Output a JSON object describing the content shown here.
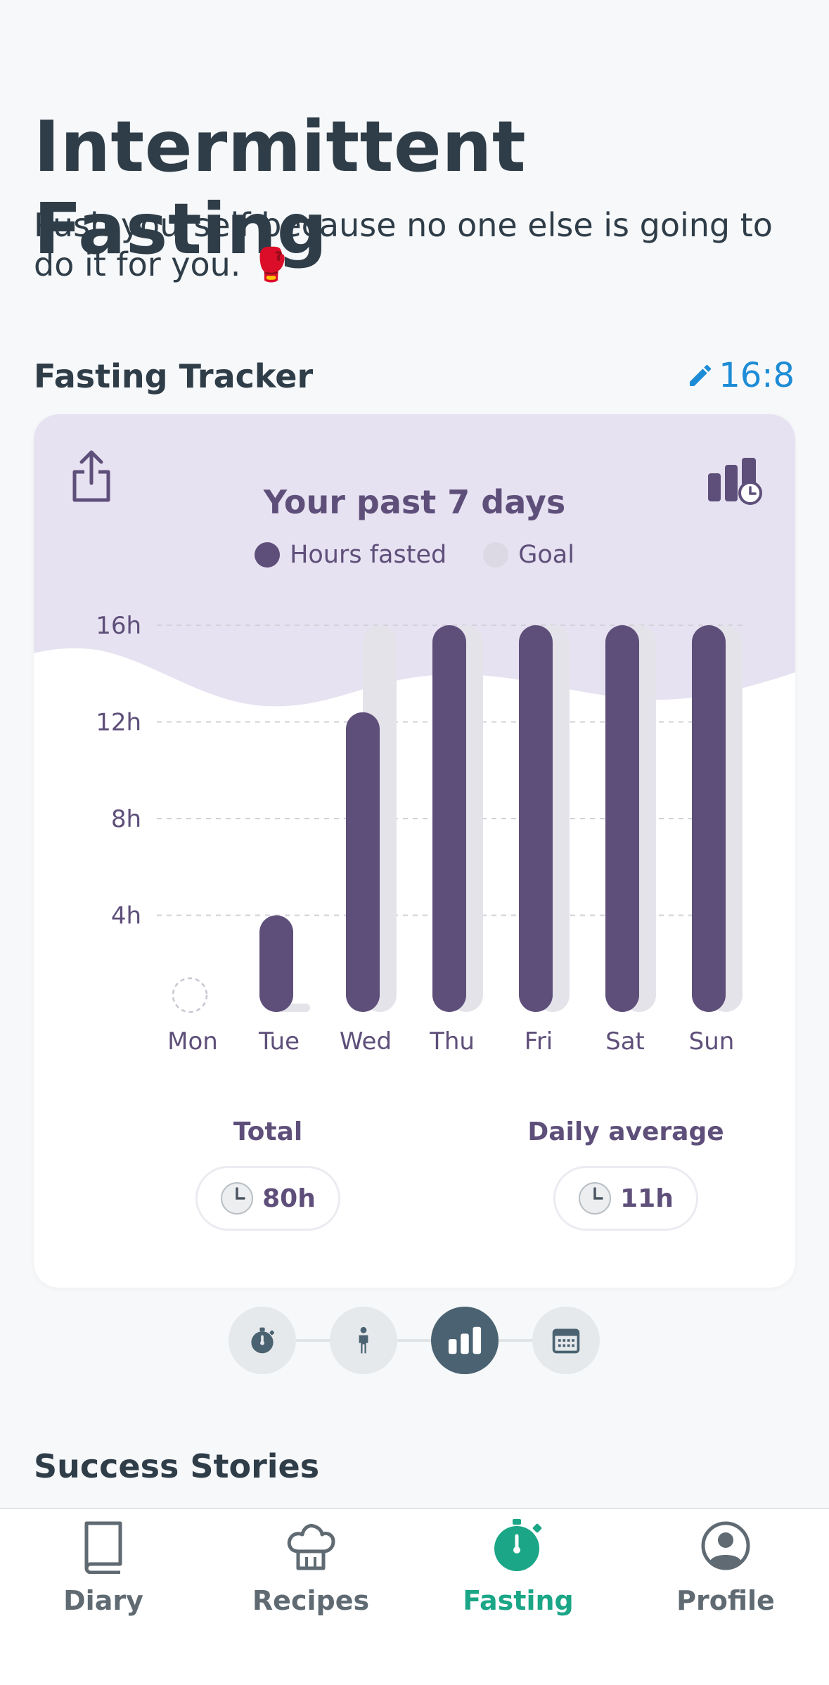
{
  "header": {
    "title": "Intermittent Fasting",
    "subtitle": "Push yourself because no one else is going to do it for you. 🥊"
  },
  "tracker": {
    "section_title": "Fasting Tracker",
    "plan": "16:8",
    "plan_icon": "pencil-icon",
    "card_title": "Your past 7 days",
    "legend": [
      {
        "label": "Hours fasted",
        "color": "#5e4f7a"
      },
      {
        "label": "Goal",
        "color": "#dcd9e4"
      }
    ],
    "total_label": "Total",
    "total_value": "80h",
    "average_label": "Daily average",
    "average_value": "11h"
  },
  "chart_data": {
    "type": "bar",
    "categories": [
      "Mon",
      "Tue",
      "Wed",
      "Thu",
      "Fri",
      "Sat",
      "Sun"
    ],
    "series": [
      {
        "name": "Hours fasted",
        "values": [
          0,
          4,
          12.4,
          16,
          16,
          16,
          16
        ]
      },
      {
        "name": "Goal",
        "values": [
          0,
          0,
          16,
          16,
          16,
          16,
          16
        ]
      }
    ],
    "y_ticks": [
      "4h",
      "8h",
      "12h",
      "16h"
    ],
    "ylim": [
      0,
      16
    ],
    "grid": true,
    "colors": {
      "fasted": "#5e4f7a",
      "goal": "#e5e3ea"
    }
  },
  "pager": {
    "items": [
      "timer-icon",
      "body-icon",
      "bar-chart-icon",
      "calendar-icon"
    ],
    "active": 2
  },
  "stories": {
    "section_title": "Success Stories"
  },
  "tabbar": {
    "tabs": [
      {
        "label": "Diary",
        "icon": "book-icon"
      },
      {
        "label": "Recipes",
        "icon": "chef-hat-icon"
      },
      {
        "label": "Fasting",
        "icon": "stopwatch-icon"
      },
      {
        "label": "Profile",
        "icon": "profile-icon"
      }
    ],
    "active": 2,
    "active_color": "#1aa687"
  }
}
